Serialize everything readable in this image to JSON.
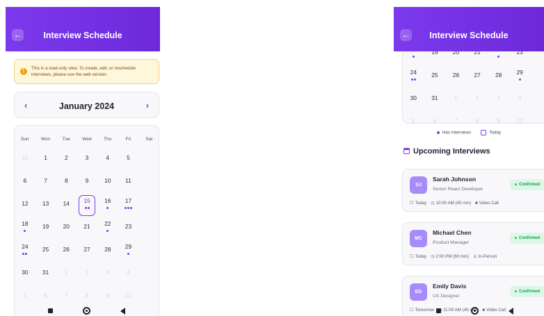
{
  "app": {
    "title": "Interview Schedule",
    "back_icon": "←"
  },
  "notice": {
    "icon": "!",
    "text": "This is a read-only view. To create, edit, or reschedule interviews, please use the web version."
  },
  "calendar": {
    "month": "January 2024",
    "prev_icon": "‹",
    "next_icon": "›",
    "weekdays": [
      "Sun",
      "Mon",
      "Tue",
      "Wed",
      "Thu",
      "Fri",
      "Sat"
    ],
    "weeks": [
      [
        {
          "n": "31",
          "o": true,
          "d": 0
        },
        {
          "n": "1",
          "d": 0
        },
        {
          "n": "2",
          "d": 0
        },
        {
          "n": "3",
          "d": 0
        },
        {
          "n": "4",
          "d": 0
        },
        {
          "n": "5",
          "d": 0
        },
        {
          "n": "",
          "d": 0
        }
      ],
      [
        {
          "n": "6",
          "d": 0
        },
        {
          "n": "7",
          "d": 0
        },
        {
          "n": "8",
          "d": 0
        },
        {
          "n": "9",
          "d": 0
        },
        {
          "n": "10",
          "d": 0
        },
        {
          "n": "11",
          "d": 0
        },
        {
          "n": "",
          "d": 0
        }
      ],
      [
        {
          "n": "12",
          "d": 0
        },
        {
          "n": "13",
          "d": 0
        },
        {
          "n": "14",
          "d": 0
        },
        {
          "n": "15",
          "d": 2,
          "t": true
        },
        {
          "n": "16",
          "d": 1
        },
        {
          "n": "17",
          "d": 3
        },
        {
          "n": "",
          "d": 0
        }
      ],
      [
        {
          "n": "18",
          "d": 1
        },
        {
          "n": "19",
          "d": 0
        },
        {
          "n": "20",
          "d": 0
        },
        {
          "n": "21",
          "d": 0
        },
        {
          "n": "22",
          "d": 1
        },
        {
          "n": "23",
          "d": 0
        },
        {
          "n": "",
          "d": 0
        }
      ],
      [
        {
          "n": "24",
          "d": 2
        },
        {
          "n": "25",
          "d": 0
        },
        {
          "n": "26",
          "d": 0
        },
        {
          "n": "27",
          "d": 0
        },
        {
          "n": "28",
          "d": 0
        },
        {
          "n": "29",
          "d": 1
        },
        {
          "n": "",
          "d": 0
        }
      ],
      [
        {
          "n": "30",
          "d": 0
        },
        {
          "n": "31",
          "d": 0
        },
        {
          "n": "1",
          "o": true,
          "d": 0
        },
        {
          "n": "2",
          "o": true,
          "d": 0
        },
        {
          "n": "3",
          "o": true,
          "d": 0
        },
        {
          "n": "4",
          "o": true,
          "d": 0
        },
        {
          "n": "",
          "d": 0
        }
      ],
      [
        {
          "n": "5",
          "o": true,
          "d": 0
        },
        {
          "n": "6",
          "o": true,
          "d": 0
        },
        {
          "n": "7",
          "o": true,
          "d": 0
        },
        {
          "n": "8",
          "o": true,
          "d": 0
        },
        {
          "n": "9",
          "o": true,
          "d": 0
        },
        {
          "n": "10",
          "o": true,
          "d": 0
        },
        {
          "n": "",
          "d": 0
        }
      ]
    ]
  },
  "legend": {
    "has_interviews": "Has interviews",
    "today": "Today"
  },
  "upcoming": {
    "title": "Upcoming Interviews",
    "items": [
      {
        "initials": "SJ",
        "name": "Sarah Johnson",
        "role": "Senior React Developer",
        "status": "Confirmed",
        "day": "Today",
        "time": "10:00 AM (45 min)",
        "mode": "Video Call",
        "mode_icon": "■"
      },
      {
        "initials": "MC",
        "name": "Michael Chen",
        "role": "Product Manager",
        "status": "Confirmed",
        "day": "Today",
        "time": "2:00 PM (60 min)",
        "mode": "In-Person",
        "mode_icon": "♙"
      },
      {
        "initials": "ED",
        "name": "Emily Davis",
        "role": "UX Designer",
        "status": "Confirmed",
        "day": "Tomorrow",
        "time": "11:00 AM (45 min)",
        "mode": "Video Call",
        "mode_icon": "■"
      }
    ]
  },
  "icons": {
    "calendar": "☐",
    "clock": "◷"
  },
  "colors": {
    "primary": "#7c3aed",
    "confirmed": "#16a34a",
    "notice_bg": "#fff7dc"
  }
}
